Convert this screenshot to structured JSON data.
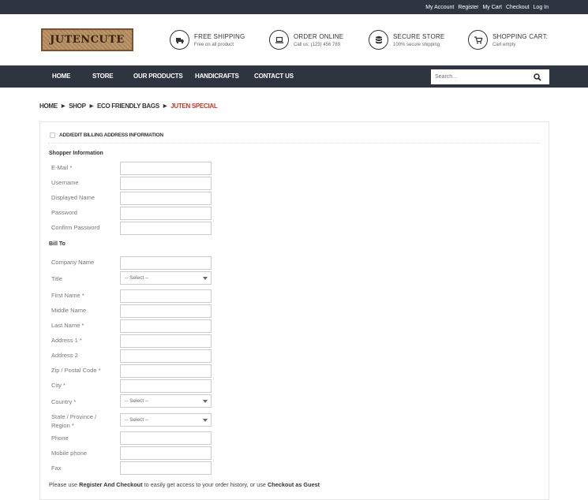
{
  "topbar": {
    "links": [
      "My Account",
      "Register",
      "My Cart",
      "Checkout",
      "Log In"
    ]
  },
  "logo": {
    "text": "JUTENCUTE"
  },
  "features": [
    {
      "icon": "truck-icon",
      "title": "FREE SHIPPING",
      "sub": "Free on all product"
    },
    {
      "icon": "laptop-icon",
      "title": "ORDER ONLINE",
      "sub": "Call us: (123) 456 789"
    },
    {
      "icon": "database-icon",
      "title": "SECURE STORE",
      "sub": "100% secure shipping"
    },
    {
      "icon": "cart-icon",
      "title": "SHOPPING CART:",
      "sub": "Cart empty"
    }
  ],
  "nav": {
    "items": [
      "HOME",
      "STORE",
      "OUR PRODUCTS",
      "HANDICRAFTS",
      "CONTACT US"
    ],
    "search_placeholder": "Search..."
  },
  "breadcrumb": {
    "items": [
      "HOME",
      "SHOP",
      "ECO FRIENDLY BAGS"
    ],
    "current": "JUTEN SPECIAL"
  },
  "form": {
    "billing_checkbox_label": "ADD/EDIT BILLING ADDRESS INFORMATION",
    "shopper_title": "Shopper Information",
    "shopper_fields": [
      "E-Mail *",
      "Username",
      "Displayed Name",
      "Password",
      "Confirm Password"
    ],
    "bill_title": "Bill To",
    "bill_fields": {
      "company": "Company Name",
      "title": "Title",
      "title_select": "-- Select --",
      "first_name": "First Name *",
      "middle_name": "Middle Name",
      "last_name": "Last Name *",
      "address1": "Address 1 *",
      "address2": "Address 2",
      "zip": "Zip / Postal Code *",
      "city": "City *",
      "country": "Country *",
      "country_select": "-- Select --",
      "state_line1": "State / Province /",
      "state_line2": "Region *",
      "state_select": "-- Select --",
      "phone": "Phone",
      "mobile": "Mobile phone",
      "fax": "Fax"
    },
    "note": {
      "prefix": "Please use ",
      "register": "Register And Checkout",
      "middle": " to easily get access to your order history, or use ",
      "guest": "Checkout as Guest"
    }
  }
}
